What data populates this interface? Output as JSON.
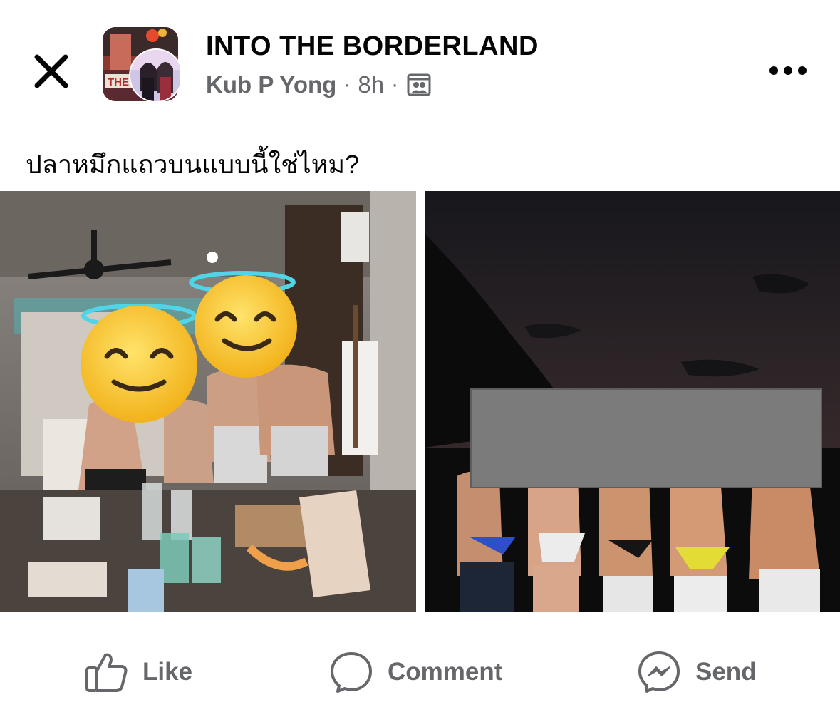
{
  "header": {
    "close_icon": "close-icon",
    "group_title": "INTO THE BORDERLAND",
    "author": "Kub P Yong",
    "separator": "·",
    "time": "8h",
    "audience_icon": "photo-album-icon",
    "more_icon": "more-horizontal-icon",
    "avatar_overlay_text": "THE"
  },
  "post": {
    "caption": "ปลาหมึกแถวบนแบบนี้ใช่ไหม?",
    "photos": [
      {
        "name": "mirror-selfie-photo"
      },
      {
        "name": "night-group-photo"
      }
    ]
  },
  "actions": {
    "like_label": "Like",
    "comment_label": "Comment",
    "send_label": "Send"
  },
  "colors": {
    "text_primary": "#050505",
    "text_secondary": "#65676b",
    "background": "#ffffff"
  }
}
